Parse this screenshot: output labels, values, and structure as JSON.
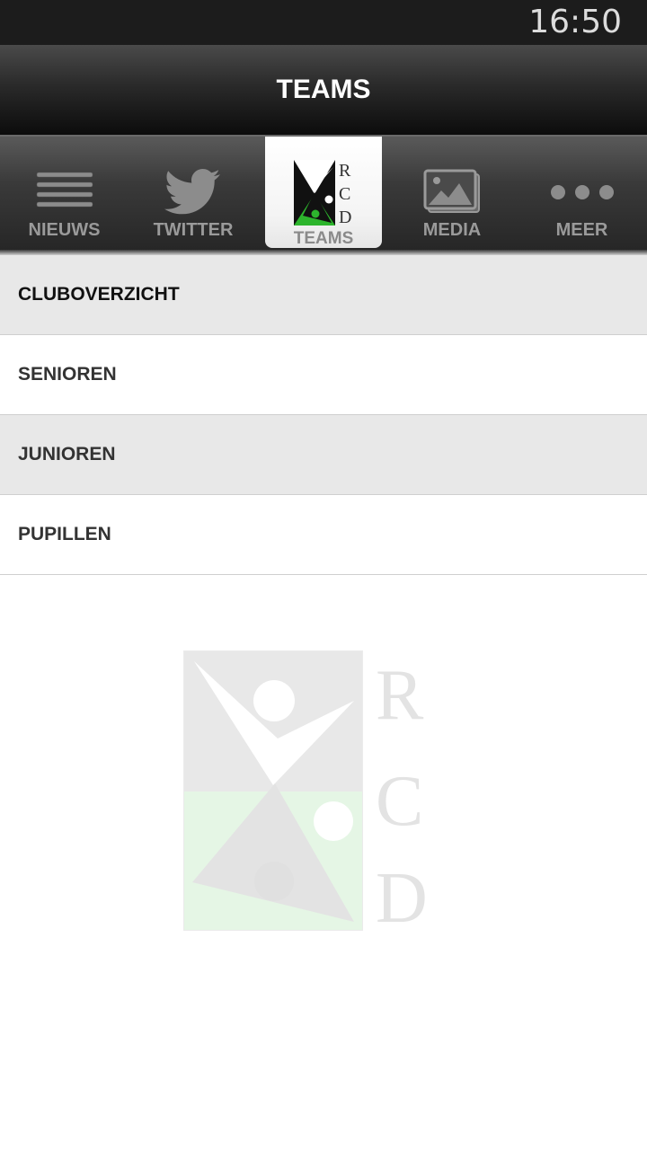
{
  "status_bar": {
    "time": "16:50"
  },
  "header": {
    "title": "TEAMS"
  },
  "tabs": [
    {
      "label": "NIEUWS",
      "icon": "menu-lines-icon",
      "active": false
    },
    {
      "label": "TWITTER",
      "icon": "twitter-bird-icon",
      "active": false
    },
    {
      "label": "TEAMS",
      "icon": "rcd-logo-icon",
      "active": true
    },
    {
      "label": "MEDIA",
      "icon": "photos-icon",
      "active": false
    },
    {
      "label": "MEER",
      "icon": "more-dots-icon",
      "active": false
    }
  ],
  "list": {
    "items": [
      {
        "label": "CLUBOVERZICHT"
      },
      {
        "label": "SENIOREN"
      },
      {
        "label": "JUNIOREN"
      },
      {
        "label": "PUPILLEN"
      }
    ]
  },
  "logo": {
    "letters": [
      "R",
      "C",
      "D"
    ]
  },
  "colors": {
    "logo_green": "#2db52d",
    "tab_text": "#9a9a9a",
    "list_shade": "#e8e8e8"
  }
}
